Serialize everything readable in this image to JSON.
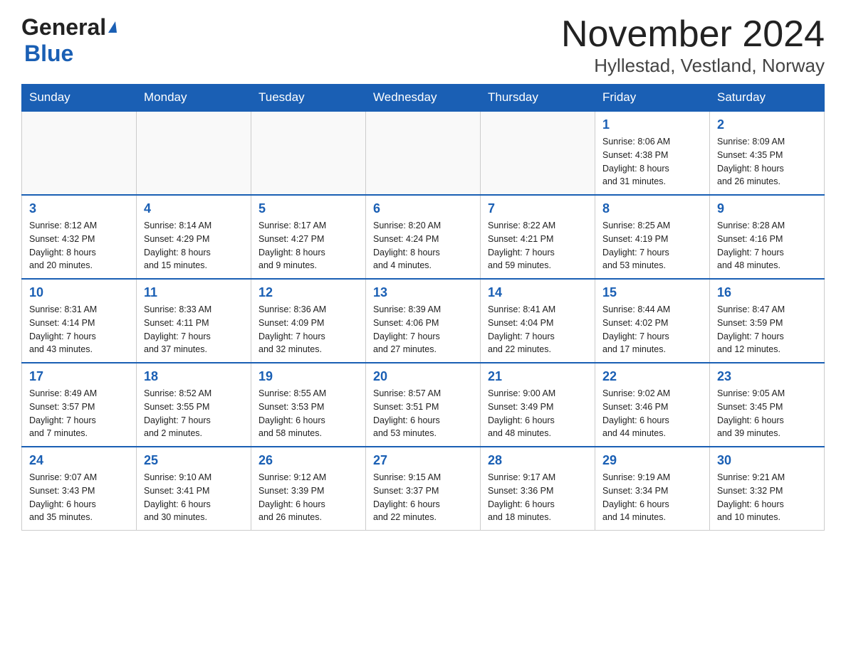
{
  "header": {
    "logo_general": "General",
    "logo_blue": "Blue",
    "month_title": "November 2024",
    "location": "Hyllestad, Vestland, Norway"
  },
  "days_of_week": [
    "Sunday",
    "Monday",
    "Tuesday",
    "Wednesday",
    "Thursday",
    "Friday",
    "Saturday"
  ],
  "weeks": [
    [
      {
        "day": "",
        "info": ""
      },
      {
        "day": "",
        "info": ""
      },
      {
        "day": "",
        "info": ""
      },
      {
        "day": "",
        "info": ""
      },
      {
        "day": "",
        "info": ""
      },
      {
        "day": "1",
        "info": "Sunrise: 8:06 AM\nSunset: 4:38 PM\nDaylight: 8 hours\nand 31 minutes."
      },
      {
        "day": "2",
        "info": "Sunrise: 8:09 AM\nSunset: 4:35 PM\nDaylight: 8 hours\nand 26 minutes."
      }
    ],
    [
      {
        "day": "3",
        "info": "Sunrise: 8:12 AM\nSunset: 4:32 PM\nDaylight: 8 hours\nand 20 minutes."
      },
      {
        "day": "4",
        "info": "Sunrise: 8:14 AM\nSunset: 4:29 PM\nDaylight: 8 hours\nand 15 minutes."
      },
      {
        "day": "5",
        "info": "Sunrise: 8:17 AM\nSunset: 4:27 PM\nDaylight: 8 hours\nand 9 minutes."
      },
      {
        "day": "6",
        "info": "Sunrise: 8:20 AM\nSunset: 4:24 PM\nDaylight: 8 hours\nand 4 minutes."
      },
      {
        "day": "7",
        "info": "Sunrise: 8:22 AM\nSunset: 4:21 PM\nDaylight: 7 hours\nand 59 minutes."
      },
      {
        "day": "8",
        "info": "Sunrise: 8:25 AM\nSunset: 4:19 PM\nDaylight: 7 hours\nand 53 minutes."
      },
      {
        "day": "9",
        "info": "Sunrise: 8:28 AM\nSunset: 4:16 PM\nDaylight: 7 hours\nand 48 minutes."
      }
    ],
    [
      {
        "day": "10",
        "info": "Sunrise: 8:31 AM\nSunset: 4:14 PM\nDaylight: 7 hours\nand 43 minutes."
      },
      {
        "day": "11",
        "info": "Sunrise: 8:33 AM\nSunset: 4:11 PM\nDaylight: 7 hours\nand 37 minutes."
      },
      {
        "day": "12",
        "info": "Sunrise: 8:36 AM\nSunset: 4:09 PM\nDaylight: 7 hours\nand 32 minutes."
      },
      {
        "day": "13",
        "info": "Sunrise: 8:39 AM\nSunset: 4:06 PM\nDaylight: 7 hours\nand 27 minutes."
      },
      {
        "day": "14",
        "info": "Sunrise: 8:41 AM\nSunset: 4:04 PM\nDaylight: 7 hours\nand 22 minutes."
      },
      {
        "day": "15",
        "info": "Sunrise: 8:44 AM\nSunset: 4:02 PM\nDaylight: 7 hours\nand 17 minutes."
      },
      {
        "day": "16",
        "info": "Sunrise: 8:47 AM\nSunset: 3:59 PM\nDaylight: 7 hours\nand 12 minutes."
      }
    ],
    [
      {
        "day": "17",
        "info": "Sunrise: 8:49 AM\nSunset: 3:57 PM\nDaylight: 7 hours\nand 7 minutes."
      },
      {
        "day": "18",
        "info": "Sunrise: 8:52 AM\nSunset: 3:55 PM\nDaylight: 7 hours\nand 2 minutes."
      },
      {
        "day": "19",
        "info": "Sunrise: 8:55 AM\nSunset: 3:53 PM\nDaylight: 6 hours\nand 58 minutes."
      },
      {
        "day": "20",
        "info": "Sunrise: 8:57 AM\nSunset: 3:51 PM\nDaylight: 6 hours\nand 53 minutes."
      },
      {
        "day": "21",
        "info": "Sunrise: 9:00 AM\nSunset: 3:49 PM\nDaylight: 6 hours\nand 48 minutes."
      },
      {
        "day": "22",
        "info": "Sunrise: 9:02 AM\nSunset: 3:46 PM\nDaylight: 6 hours\nand 44 minutes."
      },
      {
        "day": "23",
        "info": "Sunrise: 9:05 AM\nSunset: 3:45 PM\nDaylight: 6 hours\nand 39 minutes."
      }
    ],
    [
      {
        "day": "24",
        "info": "Sunrise: 9:07 AM\nSunset: 3:43 PM\nDaylight: 6 hours\nand 35 minutes."
      },
      {
        "day": "25",
        "info": "Sunrise: 9:10 AM\nSunset: 3:41 PM\nDaylight: 6 hours\nand 30 minutes."
      },
      {
        "day": "26",
        "info": "Sunrise: 9:12 AM\nSunset: 3:39 PM\nDaylight: 6 hours\nand 26 minutes."
      },
      {
        "day": "27",
        "info": "Sunrise: 9:15 AM\nSunset: 3:37 PM\nDaylight: 6 hours\nand 22 minutes."
      },
      {
        "day": "28",
        "info": "Sunrise: 9:17 AM\nSunset: 3:36 PM\nDaylight: 6 hours\nand 18 minutes."
      },
      {
        "day": "29",
        "info": "Sunrise: 9:19 AM\nSunset: 3:34 PM\nDaylight: 6 hours\nand 14 minutes."
      },
      {
        "day": "30",
        "info": "Sunrise: 9:21 AM\nSunset: 3:32 PM\nDaylight: 6 hours\nand 10 minutes."
      }
    ]
  ]
}
